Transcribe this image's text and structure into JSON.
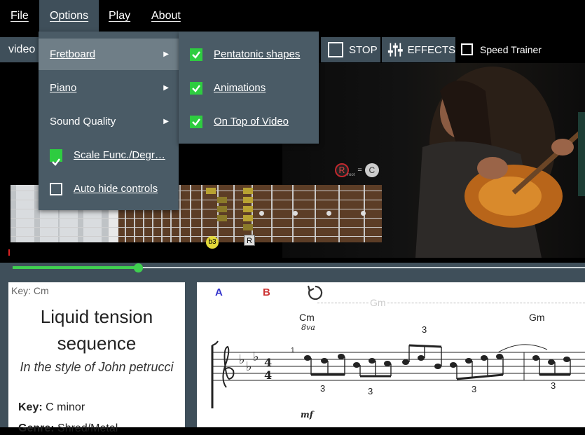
{
  "menubar": {
    "file": "File",
    "options": "Options",
    "play": "Play",
    "about": "About"
  },
  "toolbar": {
    "video_tab": "video",
    "stop_label": "STOP",
    "effects_label": "EFFECTS",
    "speed_trainer_label": "Speed Trainer",
    "speed_trainer_checked": false
  },
  "options_menu": {
    "items": [
      {
        "label": "Fretboard",
        "has_submenu": true,
        "highlighted": true
      },
      {
        "label": "Piano",
        "has_submenu": true
      },
      {
        "label": "Sound Quality",
        "has_submenu": true
      },
      {
        "label": "Scale Func./Degr…",
        "checked": true
      },
      {
        "label": "Auto hide controls",
        "checked": false
      }
    ]
  },
  "fretboard_submenu": {
    "items": [
      {
        "label": "Pentatonic shapes",
        "checked": true
      },
      {
        "label": "Animations",
        "checked": true
      },
      {
        "label": "On Top of Video",
        "checked": true
      }
    ]
  },
  "fretboard": {
    "b3_marker": "b3",
    "root_marker": "R",
    "root_indicator": {
      "r": "R",
      "sub": "root",
      "eq": "=",
      "note": "C"
    }
  },
  "timeline": {
    "progress": 0.22
  },
  "song": {
    "key_small": "Key: Cm",
    "title": "Liquid tension sequence",
    "subtitle": "In the style of John petrucci",
    "key_label": "Key:",
    "key_value": "C minor",
    "genre_label": "Genre:",
    "genre_value": "Shred/Metal"
  },
  "score": {
    "loop_a": "A",
    "loop_b": "B",
    "ghost_chord": "Gm",
    "chord1": "Cm",
    "octave_mark": "8va",
    "chord2": "Gm",
    "dynamic": "mf",
    "bar_number": "1",
    "time_signature": "4/4",
    "triplet": "3"
  },
  "colors": {
    "panel": "#3f4f5a",
    "menu_bg": "#4a5b66",
    "accent_green": "#3fcf50",
    "check_green": "#2ecc40"
  }
}
